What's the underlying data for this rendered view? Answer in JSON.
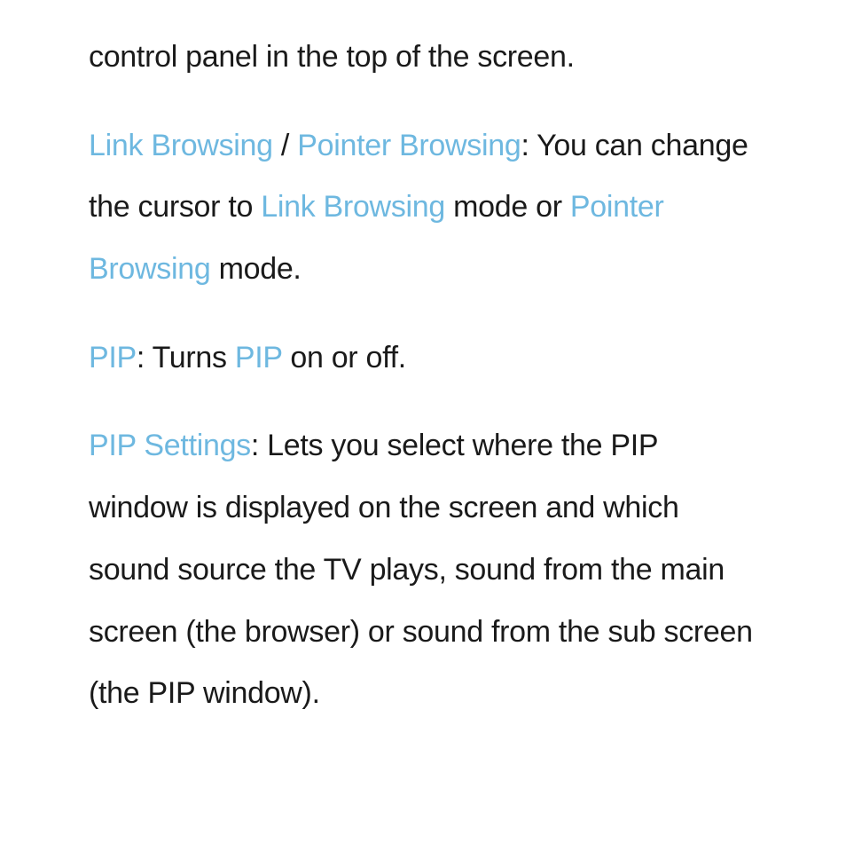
{
  "p1": {
    "text": "control panel in the top of the screen."
  },
  "p2": {
    "hl1": "Link Browsing",
    "sep1": " / ",
    "hl2": "Pointer Browsing",
    "t1": ": You can change the cursor to ",
    "hl3": "Link Browsing",
    "t2": " mode or ",
    "hl4": "Pointer Browsing",
    "t3": " mode."
  },
  "p3": {
    "hl1": "PIP",
    "t1": ": Turns ",
    "hl2": "PIP",
    "t2": " on or off."
  },
  "p4": {
    "hl1": "PIP Settings",
    "t1": ": Lets you select where the PIP window is displayed on the screen and which sound source the TV plays, sound from the main screen (the browser) or sound from the sub screen (the PIP window)."
  }
}
